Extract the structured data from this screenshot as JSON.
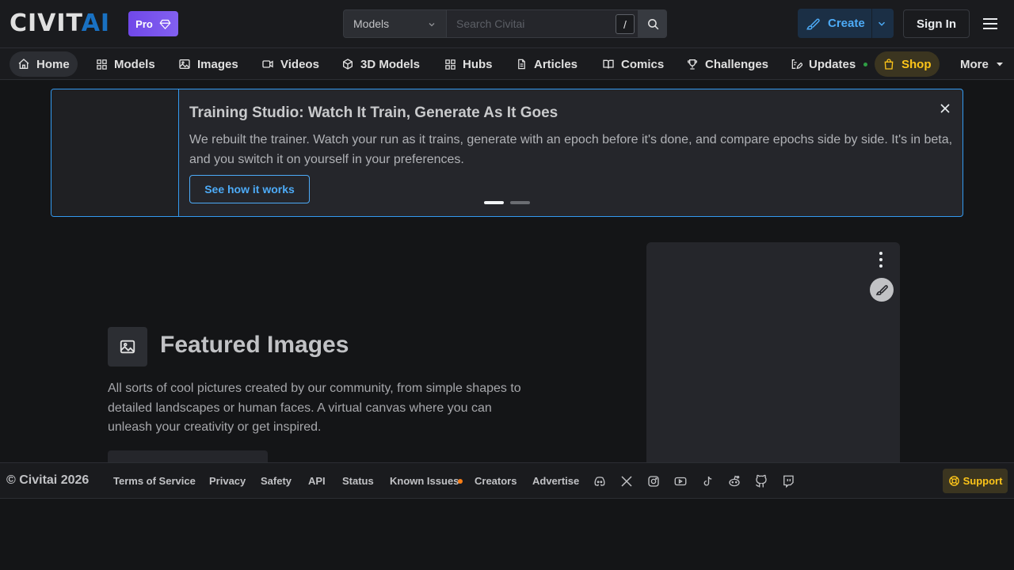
{
  "header": {
    "logo": {
      "part1": "CIVIT",
      "part2": "AI"
    },
    "pro_label": "Pro",
    "search": {
      "category": "Models",
      "placeholder": "Search Civitai",
      "shortcut": "/"
    },
    "create_label": "Create",
    "signin_label": "Sign In"
  },
  "nav": {
    "items": [
      {
        "label": "Home",
        "icon": "home-icon"
      },
      {
        "label": "Models",
        "icon": "grid-icon"
      },
      {
        "label": "Images",
        "icon": "image-icon"
      },
      {
        "label": "Videos",
        "icon": "video-icon"
      },
      {
        "label": "3D Models",
        "icon": "cube-icon"
      },
      {
        "label": "Hubs",
        "icon": "grid-icon"
      },
      {
        "label": "Articles",
        "icon": "file-text-icon"
      },
      {
        "label": "Comics",
        "icon": "book-icon"
      },
      {
        "label": "Challenges",
        "icon": "trophy-icon"
      },
      {
        "label": "Updates",
        "icon": "edit-list-icon"
      },
      {
        "label": "Shop",
        "icon": "shopping-bag-icon"
      }
    ],
    "more_label": "More"
  },
  "banner": {
    "title": "Training Studio: Watch It Train, Generate As It Goes",
    "description": "We rebuilt the trainer. Watch your run as it trains, generate with an epoch before it's done, and compare epochs side by side. It's in beta, and you switch it on yourself in your preferences.",
    "cta_label": "See how it works",
    "page_count": 2,
    "active_page": 1
  },
  "featured": {
    "title": "Featured Images",
    "description": "All sorts of cool pictures created by our community, from simple shapes to detailed landscapes or human faces. A virtual canvas where you can unleash your creativity or get inspired."
  },
  "footer": {
    "copyright": "© Civitai 2026",
    "links": [
      "Terms of Service",
      "Privacy",
      "Safety",
      "API",
      "Status",
      "Known Issues",
      "Creators",
      "Advertise"
    ],
    "socials": [
      "discord-icon",
      "x-icon",
      "instagram-icon",
      "youtube-icon",
      "tiktok-icon",
      "reddit-icon",
      "github-icon",
      "twitch-icon"
    ],
    "support_label": "Support"
  },
  "colors": {
    "accent_blue": "#339af0",
    "pro_purple": "#7048e8",
    "shop_yellow": "#fcc419",
    "status_orange": "#fd7e14",
    "update_green": "#2f9e44"
  }
}
